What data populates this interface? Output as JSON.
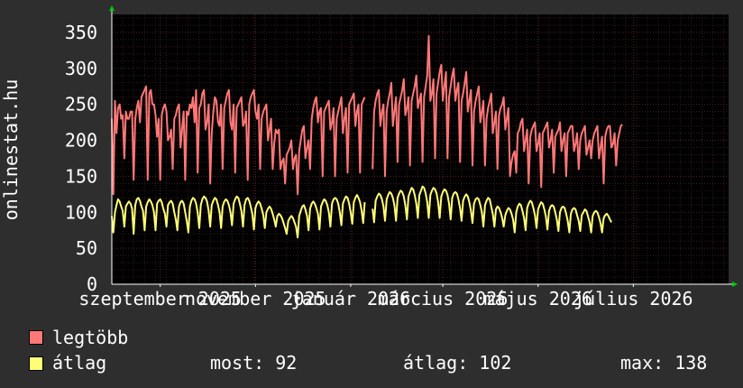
{
  "colors": {
    "background": "#2e2e2e",
    "plot_bg": "#000000",
    "grid_minor": "#3a1a1a",
    "grid_major": "#5a2020",
    "axis": "#ffffff",
    "arrow": "#00cc00",
    "max_series": "#ff7777",
    "avg_series": "#ffff77"
  },
  "chart_data": {
    "type": "line",
    "ylabel": "onlinestat.hu",
    "ylim": [
      0,
      375
    ],
    "yticks": [
      0,
      50,
      100,
      150,
      200,
      250,
      300,
      350
    ],
    "x_start": "2025-08-01",
    "x_end": "2026-08-31",
    "x_ticks": [
      {
        "date": "2025-09-01",
        "label": "szeptember 2025"
      },
      {
        "date": "2025-11-01",
        "label": "november 2025"
      },
      {
        "date": "2026-01-01",
        "label": "január 2026"
      },
      {
        "date": "2026-03-01",
        "label": "március 2026"
      },
      {
        "date": "2026-05-01",
        "label": "május 2026"
      },
      {
        "date": "2026-07-01",
        "label": "július 2026"
      }
    ],
    "series": [
      {
        "name": "legtöbb",
        "color": "#ff7777",
        "start": "2025-08-01",
        "gaps": [
          [
            163,
            166
          ]
        ],
        "values": [
          230,
          125,
          255,
          210,
          245,
          250,
          230,
          235,
          175,
          240,
          230,
          230,
          240,
          240,
          145,
          230,
          245,
          255,
          225,
          260,
          265,
          270,
          275,
          145,
          265,
          270,
          250,
          250,
          235,
          205,
          230,
          145,
          235,
          245,
          250,
          240,
          200,
          205,
          215,
          160,
          230,
          235,
          245,
          250,
          190,
          215,
          240,
          145,
          240,
          235,
          250,
          245,
          260,
          225,
          270,
          155,
          245,
          250,
          265,
          270,
          215,
          225,
          250,
          140,
          210,
          240,
          260,
          255,
          225,
          220,
          250,
          160,
          245,
          255,
          265,
          270,
          225,
          215,
          250,
          155,
          245,
          250,
          255,
          260,
          220,
          225,
          240,
          145,
          250,
          260,
          265,
          270,
          240,
          230,
          250,
          160,
          230,
          240,
          245,
          250,
          200,
          215,
          230,
          160,
          195,
          215,
          210,
          215,
          160,
          170,
          175,
          140,
          180,
          185,
          190,
          200,
          160,
          175,
          180,
          125,
          185,
          200,
          215,
          220,
          175,
          190,
          200,
          160,
          230,
          245,
          255,
          260,
          225,
          240,
          245,
          150,
          240,
          245,
          250,
          255,
          215,
          225,
          245,
          150,
          230,
          240,
          250,
          260,
          210,
          230,
          245,
          155,
          250,
          255,
          260,
          265,
          220,
          240,
          250,
          155,
          250,
          255,
          260,
          255,
          230,
          235,
          245,
          160,
          240,
          255,
          265,
          270,
          220,
          240,
          250,
          150,
          240,
          255,
          265,
          280,
          220,
          240,
          260,
          170,
          250,
          260,
          270,
          285,
          235,
          245,
          260,
          165,
          255,
          265,
          275,
          290,
          245,
          255,
          265,
          170,
          260,
          275,
          290,
          345,
          255,
          265,
          285,
          175,
          265,
          280,
          295,
          305,
          255,
          275,
          295,
          175,
          260,
          275,
          290,
          300,
          255,
          270,
          280,
          170,
          255,
          265,
          280,
          295,
          240,
          255,
          270,
          165,
          240,
          255,
          265,
          275,
          225,
          240,
          255,
          165,
          230,
          245,
          255,
          265,
          210,
          225,
          240,
          160,
          235,
          245,
          250,
          260,
          215,
          230,
          245,
          150,
          170,
          180,
          185,
          155,
          210,
          215,
          225,
          230,
          185,
          200,
          215,
          140,
          205,
          215,
          220,
          225,
          185,
          195,
          210,
          135,
          210,
          215,
          220,
          225,
          190,
          200,
          215,
          155,
          205,
          210,
          215,
          225,
          185,
          200,
          210,
          150,
          210,
          215,
          220,
          220,
          185,
          195,
          210,
          160,
          200,
          210,
          215,
          220,
          180,
          190,
          200,
          175,
          200,
          210,
          215,
          220,
          175,
          190,
          205,
          140,
          205,
          215,
          220,
          220,
          190,
          195,
          210,
          165,
          200,
          210,
          220,
          222
        ]
      },
      {
        "name": "átlag",
        "color": "#ffff77",
        "start": "2025-08-01",
        "gaps": [
          [
            163,
            166
          ]
        ],
        "values": [
          95,
          72,
          100,
          110,
          118,
          115,
          108,
          102,
          80,
          108,
          112,
          115,
          112,
          105,
          70,
          110,
          118,
          120,
          116,
          108,
          102,
          75,
          108,
          114,
          118,
          115,
          110,
          100,
          75,
          112,
          116,
          118,
          114,
          105,
          98,
          80,
          110,
          114,
          116,
          112,
          100,
          90,
          75,
          108,
          114,
          116,
          112,
          100,
          88,
          72,
          108,
          116,
          120,
          118,
          112,
          100,
          78,
          110,
          118,
          122,
          120,
          115,
          102,
          80,
          110,
          116,
          120,
          118,
          110,
          100,
          78,
          108,
          115,
          118,
          116,
          110,
          100,
          82,
          112,
          118,
          122,
          120,
          112,
          102,
          80,
          110,
          118,
          120,
          116,
          108,
          98,
          76,
          106,
          112,
          115,
          112,
          105,
          96,
          78,
          100,
          105,
          108,
          105,
          98,
          90,
          80,
          95,
          98,
          96,
          92,
          85,
          78,
          70,
          88,
          92,
          95,
          92,
          86,
          80,
          65,
          95,
          102,
          108,
          110,
          104,
          95,
          75,
          105,
          112,
          115,
          112,
          106,
          98,
          76,
          108,
          114,
          118,
          116,
          110,
          100,
          80,
          112,
          118,
          120,
          118,
          112,
          100,
          82,
          112,
          118,
          122,
          120,
          112,
          100,
          84,
          114,
          120,
          124,
          120,
          114,
          102,
          85,
          114,
          120,
          124,
          122,
          115,
          105,
          86,
          116,
          122,
          126,
          124,
          118,
          108,
          88,
          118,
          124,
          128,
          126,
          120,
          110,
          88,
          120,
          126,
          130,
          128,
          122,
          110,
          90,
          122,
          128,
          134,
          132,
          124,
          112,
          92,
          124,
          130,
          136,
          134,
          126,
          114,
          92,
          124,
          130,
          134,
          132,
          126,
          114,
          92,
          122,
          128,
          132,
          130,
          124,
          112,
          90,
          120,
          126,
          128,
          126,
          118,
          106,
          88,
          116,
          122,
          125,
          122,
          114,
          102,
          85,
          112,
          118,
          120,
          118,
          110,
          100,
          80,
          110,
          116,
          120,
          118,
          108,
          98,
          80,
          104,
          108,
          106,
          100,
          92,
          80,
          96,
          102,
          106,
          104,
          98,
          90,
          72,
          100,
          108,
          112,
          110,
          102,
          92,
          75,
          106,
          112,
          116,
          114,
          106,
          96,
          78,
          104,
          110,
          114,
          112,
          104,
          94,
          76,
          102,
          108,
          110,
          108,
          100,
          90,
          74,
          100,
          106,
          108,
          106,
          98,
          88,
          72,
          98,
          104,
          106,
          104,
          96,
          88,
          74,
          96,
          100,
          104,
          102,
          94,
          86,
          72,
          95,
          100,
          102,
          100,
          93,
          85,
          72,
          92,
          96,
          98,
          95,
          90,
          86
        ]
      }
    ]
  },
  "legend": {
    "max_label": "legtöbb",
    "avg_label": "átlag",
    "stats": {
      "most": "most: 92",
      "atlag": "átlag: 102",
      "max": "max: 138"
    }
  }
}
